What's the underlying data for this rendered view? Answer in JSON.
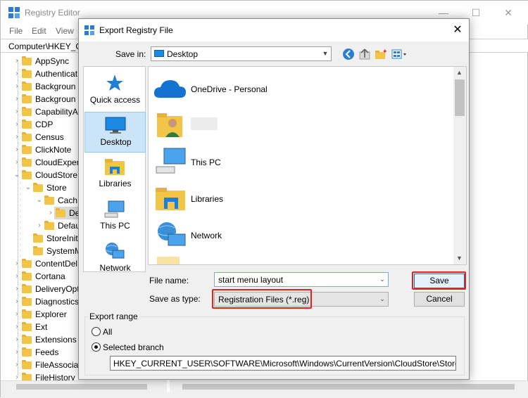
{
  "regedit": {
    "title": "Registry Editor",
    "window_controls": {
      "minimize": "—",
      "maximize": "☐",
      "close": "✕"
    },
    "menu": [
      "File",
      "Edit",
      "View"
    ],
    "address": "Computer\\HKEY_C",
    "tree": [
      {
        "label": "AppSync",
        "indent": 0,
        "expander": "›"
      },
      {
        "label": "Authenticat",
        "indent": 0,
        "expander": "›"
      },
      {
        "label": "Backgroun",
        "indent": 0,
        "expander": "›"
      },
      {
        "label": "Backgroun",
        "indent": 0,
        "expander": "›"
      },
      {
        "label": "CapabilityA",
        "indent": 0,
        "expander": "›"
      },
      {
        "label": "CDP",
        "indent": 0,
        "expander": "›"
      },
      {
        "label": "Census",
        "indent": 0,
        "expander": "›"
      },
      {
        "label": "ClickNote",
        "indent": 0,
        "expander": "›"
      },
      {
        "label": "CloudExper",
        "indent": 0,
        "expander": "›"
      },
      {
        "label": "CloudStore",
        "indent": 0,
        "expander": "⌄"
      },
      {
        "label": "Store",
        "indent": 1,
        "expander": "⌄"
      },
      {
        "label": "Cach",
        "indent": 2,
        "expander": "⌄"
      },
      {
        "label": "De",
        "indent": 3,
        "expander": "›",
        "selected": true
      },
      {
        "label": "Defau",
        "indent": 2,
        "expander": "›"
      },
      {
        "label": "StoreInit",
        "indent": 1,
        "expander": ""
      },
      {
        "label": "SystemM",
        "indent": 1,
        "expander": ""
      },
      {
        "label": "ContentDel",
        "indent": 0,
        "expander": "›"
      },
      {
        "label": "Cortana",
        "indent": 0,
        "expander": "›"
      },
      {
        "label": "DeliveryOpt",
        "indent": 0,
        "expander": "›"
      },
      {
        "label": "Diagnostics",
        "indent": 0,
        "expander": "›"
      },
      {
        "label": "Explorer",
        "indent": 0,
        "expander": "›"
      },
      {
        "label": "Ext",
        "indent": 0,
        "expander": "›"
      },
      {
        "label": "Extensions",
        "indent": 0,
        "expander": "›"
      },
      {
        "label": "Feeds",
        "indent": 0,
        "expander": "›"
      },
      {
        "label": "FileAssociat",
        "indent": 0,
        "expander": "›"
      },
      {
        "label": "FileHistory",
        "indent": 0,
        "expander": "›"
      }
    ]
  },
  "dialog": {
    "title": "Export Registry File",
    "close": "✕",
    "save_in_label": "Save in:",
    "save_in_value": "Desktop",
    "toolbar_icons": [
      "back-icon",
      "up-folder-icon",
      "new-folder-icon",
      "view-menu-icon"
    ],
    "places": [
      {
        "label": "Quick access",
        "icon": "star-icon"
      },
      {
        "label": "Desktop",
        "icon": "desktop-icon",
        "selected": true
      },
      {
        "label": "Libraries",
        "icon": "libraries-icon"
      },
      {
        "label": "This PC",
        "icon": "this-pc-icon"
      },
      {
        "label": "Network",
        "icon": "network-icon"
      }
    ],
    "files": [
      {
        "label": "OneDrive - Personal",
        "icon": "onedrive-cloud-icon"
      },
      {
        "label": "",
        "icon": "user-folder-icon"
      },
      {
        "label": "This PC",
        "icon": "this-pc-icon"
      },
      {
        "label": "Libraries",
        "icon": "libraries-folder-icon"
      },
      {
        "label": "Network",
        "icon": "network-icon"
      }
    ],
    "file_name_label": "File name:",
    "file_name_value": "start menu layout",
    "save_as_type_label": "Save as type:",
    "save_as_type_value": "Registration Files (*.reg)",
    "save_button": "Save",
    "cancel_button": "Cancel",
    "export_range": {
      "legend": "Export range",
      "all_label": "All",
      "selected_branch_label": "Selected branch",
      "selected": "selected_branch",
      "branch_path": "HKEY_CURRENT_USER\\SOFTWARE\\Microsoft\\Windows\\CurrentVersion\\CloudStore\\Store\\Cache\\"
    }
  },
  "colors": {
    "highlight_box": "#e8201c",
    "selection": "#cce4f7",
    "accent": "#0078d7",
    "folder": "#f3c546"
  }
}
